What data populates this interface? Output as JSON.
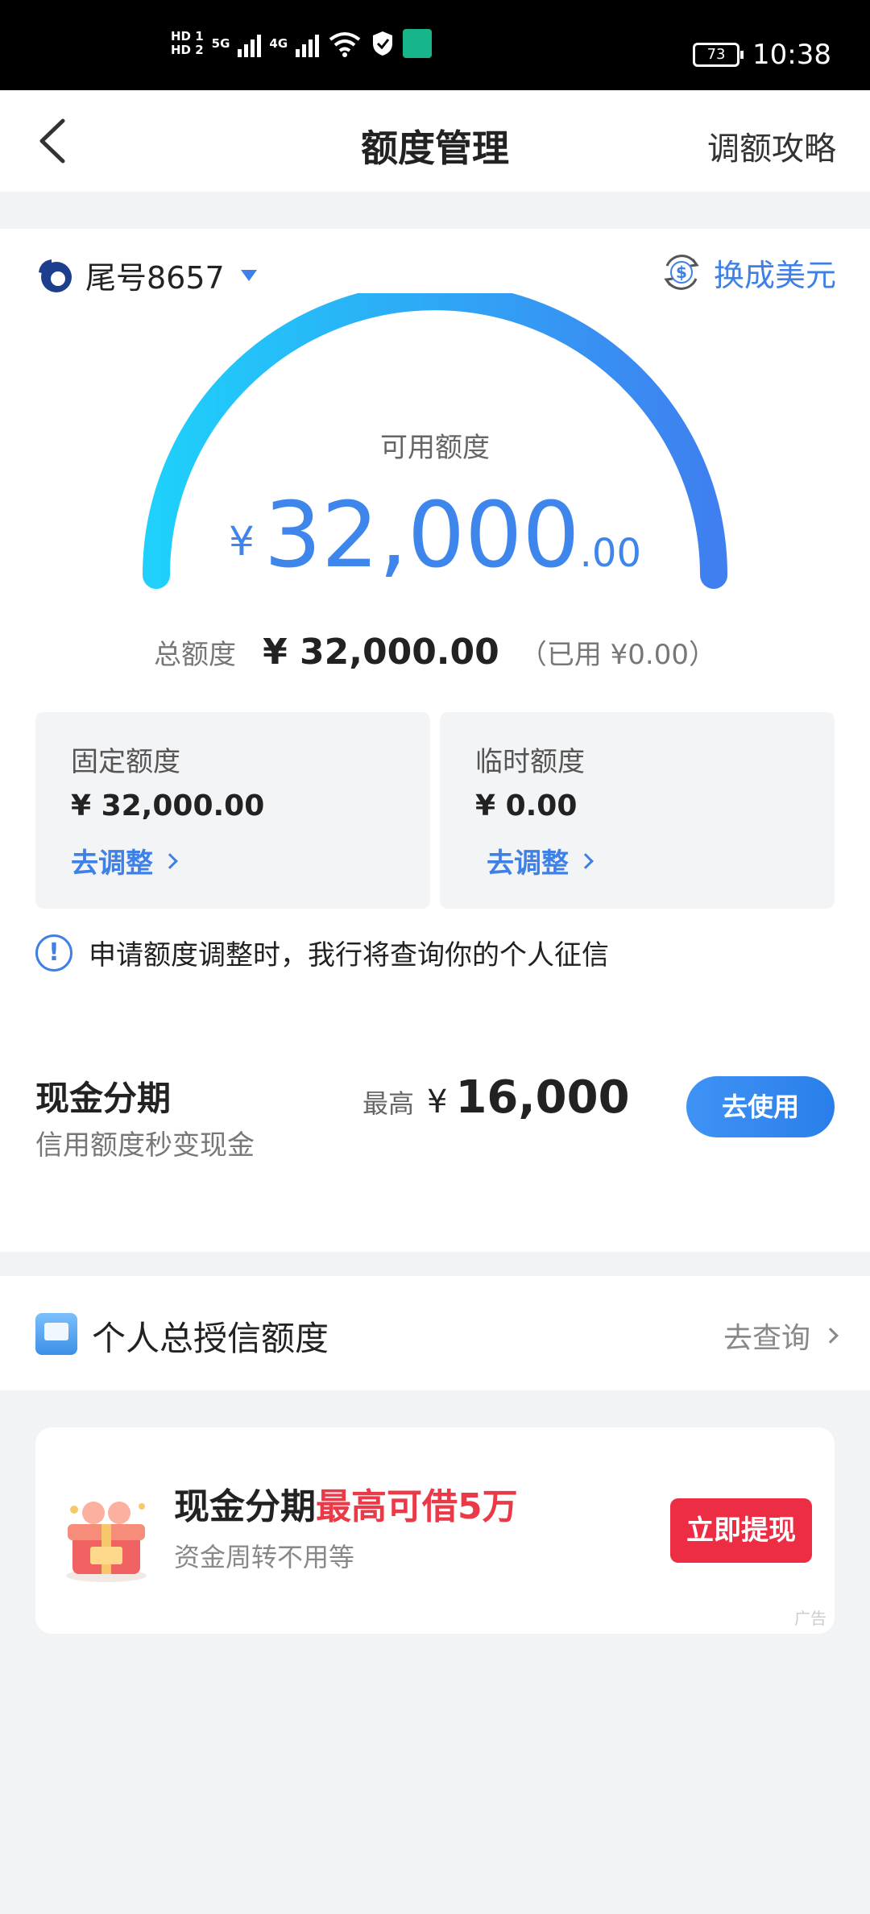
{
  "status_bar": {
    "hd1": "HD 1",
    "hd2": "HD 2",
    "net1": "5G",
    "net2": "4G",
    "wifi_label": "6",
    "battery": "73",
    "time": "10:38"
  },
  "nav": {
    "title": "额度管理",
    "right_link": "调额攻略"
  },
  "account": {
    "label": "尾号8657",
    "usd_switch": "换成美元"
  },
  "gauge": {
    "label": "可用额度",
    "currency": "¥",
    "integer": "32,000",
    "decimal": ".00",
    "fill": 1.0,
    "color_start": "#1ed0fb",
    "color_end": "#3f7ff0"
  },
  "total": {
    "label": "总额度",
    "value": "¥ 32,000.00",
    "used": "（已用 ¥0.00）"
  },
  "fixed_quota": {
    "title": "固定额度",
    "value": "¥ 32,000.00",
    "link": "去调整"
  },
  "temp_quota": {
    "title": "临时额度",
    "value": "¥ 0.00",
    "link": "去调整"
  },
  "notice": {
    "icon": "!",
    "text": "申请额度调整时，我行将查询你的个人征信"
  },
  "cash_installment": {
    "title": "现金分期",
    "subtitle": "信用额度秒变现金",
    "max_label": "最高",
    "max_currency": "¥",
    "max_value": "16,000",
    "button": "去使用"
  },
  "personal_credit": {
    "title": "个人总授信额度",
    "link": "去查询"
  },
  "ad": {
    "title_plain": "现金分期",
    "title_highlight": "最高可借5万",
    "subtitle": "资金周转不用等",
    "button": "立即提现",
    "tag": "广告"
  }
}
